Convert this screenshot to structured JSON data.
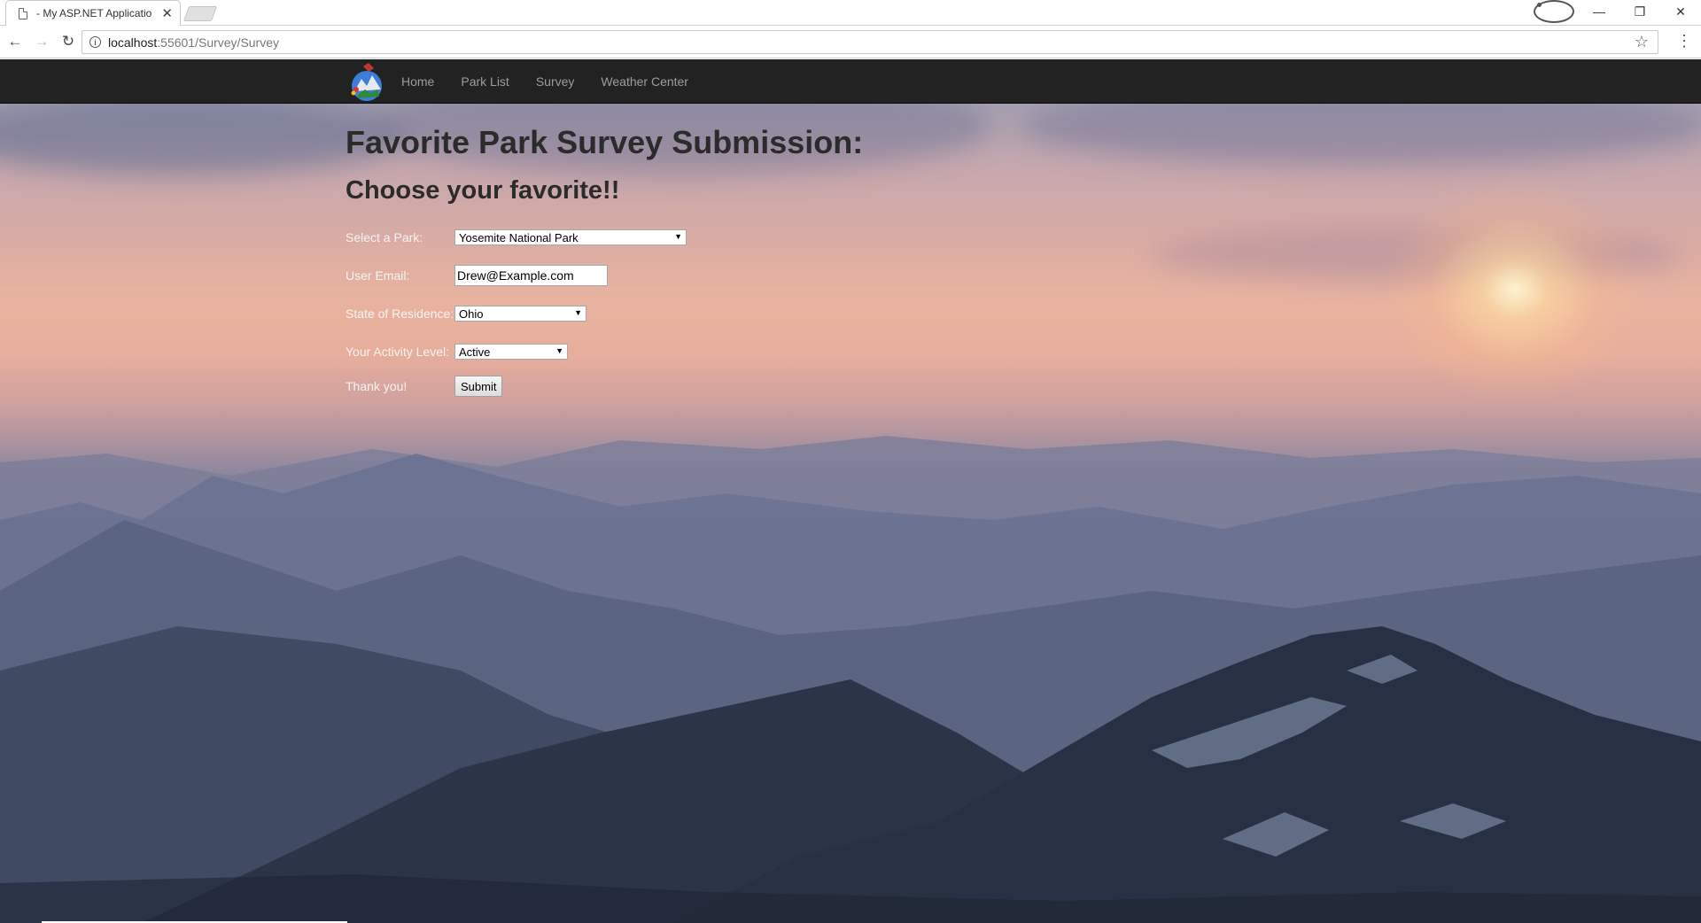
{
  "browser": {
    "tab_title": "- My ASP.NET Applicatio",
    "url_host": "localhost",
    "url_path": ":55601/Survey/Survey"
  },
  "navbar": {
    "links": [
      "Home",
      "Park List",
      "Survey",
      "Weather Center"
    ]
  },
  "page": {
    "title": "Favorite Park Survey Submission:",
    "subtitle": "Choose your favorite!!"
  },
  "form": {
    "park_label": "Select a Park:",
    "park_value": "Yosemite National Park",
    "email_label": "User Email:",
    "email_value": "Drew@Example.com",
    "state_label": "State of Residence:",
    "state_value": "Ohio",
    "activity_label": "Your Activity Level:",
    "activity_value": "Active",
    "thanks_label": "Thank you!",
    "submit_label": "Submit"
  }
}
